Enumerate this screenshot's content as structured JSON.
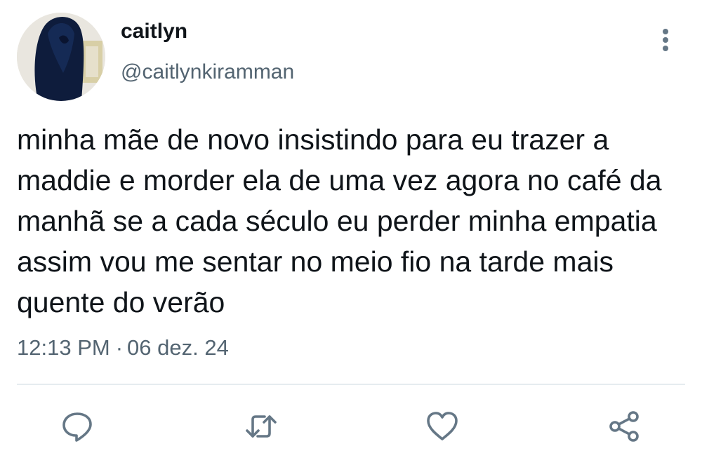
{
  "user": {
    "display_name": "caitlyn",
    "handle": "@caitlynkiramman"
  },
  "tweet": {
    "text": "minha mãe de novo insistindo para eu trazer a maddie e morder ela de uma vez agora no café da manhã se a cada século eu perder minha empatia assim vou me sentar no meio fio na tarde mais quente do verão",
    "time": "12:13 PM",
    "separator": "·",
    "date": "06 dez. 24"
  },
  "actions": {
    "reply_icon": "reply-icon",
    "retweet_icon": "retweet-icon",
    "like_icon": "like-icon",
    "share_icon": "share-icon"
  },
  "colors": {
    "text": "#0f1419",
    "secondary": "#536471",
    "icon": "#657786",
    "divider": "#e6ecf0"
  }
}
